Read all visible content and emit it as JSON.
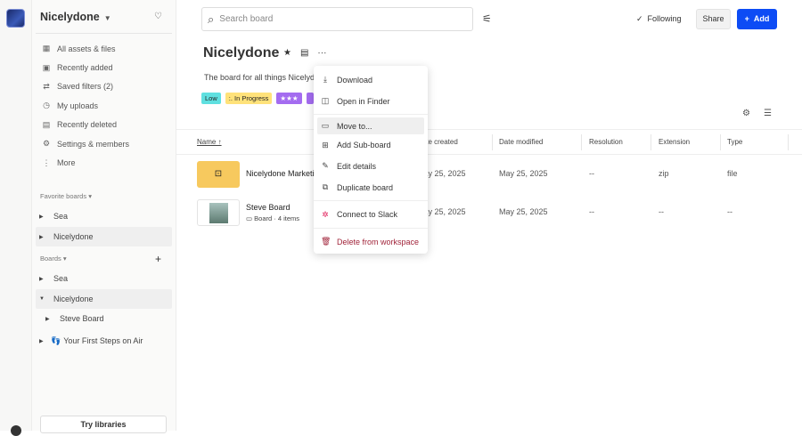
{
  "workspace": {
    "name": "Nicelydone"
  },
  "nav": [
    {
      "icon": "assets-icon",
      "glyph": "▦",
      "label": "All assets & files"
    },
    {
      "icon": "recently-added-icon",
      "glyph": "▣",
      "label": "Recently added"
    },
    {
      "icon": "saved-filters-icon",
      "glyph": "⇄",
      "label": "Saved filters (2)"
    },
    {
      "icon": "clock-icon",
      "glyph": "◷",
      "label": "My uploads"
    },
    {
      "icon": "trash-icon",
      "glyph": "▤",
      "label": "Recently deleted"
    },
    {
      "icon": "gear-icon",
      "glyph": "⚙",
      "label": "Settings & members"
    },
    {
      "icon": "more-icon",
      "glyph": "⋮",
      "label": "More"
    }
  ],
  "favorites": {
    "label": "Favorite boards",
    "items": [
      "Sea",
      "Nicelydone"
    ]
  },
  "boards": {
    "label": "Boards",
    "items": [
      "Sea",
      "Nicelydone",
      "Steve Board",
      "Your First Steps on Air"
    ]
  },
  "try_libraries": "Try libraries",
  "search": {
    "placeholder": "Search board"
  },
  "header": {
    "following": "Following",
    "share": "Share",
    "add": "Add"
  },
  "board": {
    "title": "Nicelydone",
    "description": "The board for all things Nicelydo",
    "tags": [
      {
        "label": "Low",
        "color": "#5fe0e0"
      },
      {
        "label": ":. In Progress",
        "color": "#ffe27a"
      },
      {
        "label": "★★★",
        "color": "#a46cf0"
      },
      {
        "label": "",
        "color": "#a46cf0"
      }
    ]
  },
  "table": {
    "columns": [
      "Name ↑",
      "Date created",
      "Date modified",
      "Resolution",
      "Extension",
      "Type"
    ],
    "rows": [
      {
        "name": "Nicelydone Marketi",
        "sub": "",
        "created": "May 25, 2025",
        "modified": "May 25, 2025",
        "resolution": "--",
        "extension": "zip",
        "type": "file"
      },
      {
        "name": "Steve Board",
        "sub": "Board · 4 items",
        "created": "May 25, 2025",
        "modified": "May 25, 2025",
        "resolution": "--",
        "extension": "--",
        "type": "--"
      }
    ]
  },
  "menu": {
    "items": [
      "Download",
      "Open in Finder",
      "Move to...",
      "Add Sub-board",
      "Edit details",
      "Duplicate board",
      "Connect to Slack",
      "Delete from workspace"
    ]
  }
}
